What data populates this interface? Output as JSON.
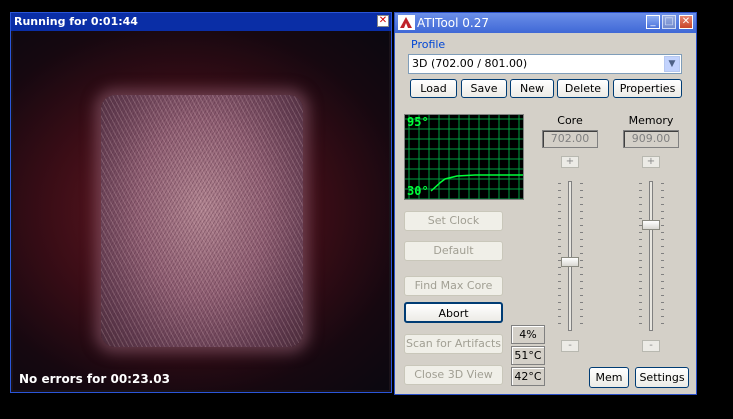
{
  "render_window": {
    "title": "Running for 0:01:44",
    "status": "No errors for 00:23.03"
  },
  "atitool": {
    "title": "ATITool 0.27",
    "profile_label": "Profile",
    "profile_value": "3D (702.00 / 801.00)",
    "buttons": {
      "load": "Load",
      "save": "Save",
      "new": "New",
      "delete": "Delete",
      "properties": "Properties",
      "set_clock": "Set Clock",
      "default": "Default",
      "find_max_core": "Find Max Core",
      "abort": "Abort",
      "scan_artifacts": "Scan for Artifacts",
      "close_3d_view": "Close 3D View",
      "mem": "Mem",
      "settings": "Settings"
    },
    "graph": {
      "top_label": "95°",
      "bottom_label": "30°",
      "line_color": "#00ff3b",
      "grid_color": "#00a040"
    },
    "core": {
      "label": "Core",
      "value": "702.00",
      "plus": "+",
      "minus": "-",
      "slider_level": 0.46
    },
    "memory": {
      "label": "Memory",
      "value": "909.00",
      "plus": "+",
      "minus": "-",
      "slider_level": 0.72
    },
    "stats": {
      "percent": "4%",
      "temp1": "51°C",
      "temp2": "42°C"
    }
  }
}
